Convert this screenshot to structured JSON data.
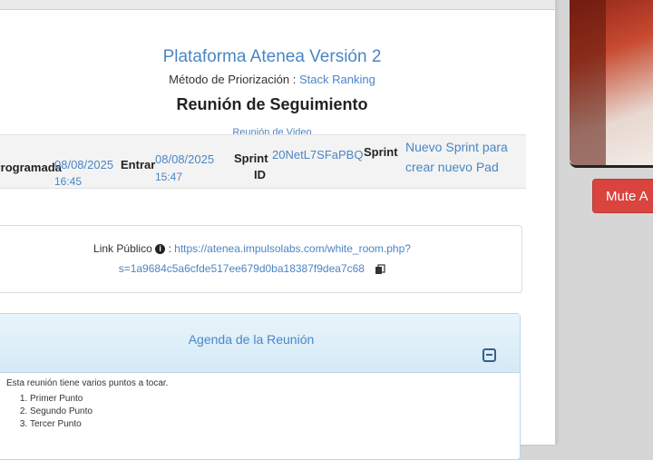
{
  "header": {
    "platform_title": "Plataforma Atenea Versión 2",
    "method_label": "Método de Priorización :",
    "method_value": "Stack Ranking",
    "meeting_title": "Reunión de Seguimiento",
    "meeting_subtitle": "Reunión de Video"
  },
  "info": {
    "scheduled_label": "Programada",
    "scheduled_date": "08/08/2025",
    "scheduled_time": "16:45",
    "enter_label": "Entrar",
    "enter_date": "08/08/2025",
    "enter_time": "15:47",
    "sprint_id_label_1": "Sprint",
    "sprint_id_label_2": "ID",
    "sprint_id_value": "20NetL7SFaPBQ",
    "sprint_label": "Sprint",
    "sprint_value_1": "Nuevo Sprint para",
    "sprint_value_2": "crear nuevo Pad"
  },
  "public_link": {
    "label": "Link Público",
    "url_part1": "https://atenea.impulsolabs.com/white_room.php?",
    "url_part2": "s=1a9684c5a6cfde517ee679d0ba18387f9dea7c68"
  },
  "agenda": {
    "title": "Agenda de la Reunión",
    "intro": "Esta reunión tiene varios puntos a tocar.",
    "items": [
      "Primer Punto",
      "Segundo Punto",
      "Tercer Punto"
    ]
  },
  "controls": {
    "mute_label": "Mute A"
  },
  "colors": {
    "link_blue": "#4a86c5",
    "mute_red": "#d9443f",
    "agenda_header": "#d4eaf6"
  },
  "icons": [
    "info-icon",
    "copy-icon",
    "collapse-icon"
  ]
}
